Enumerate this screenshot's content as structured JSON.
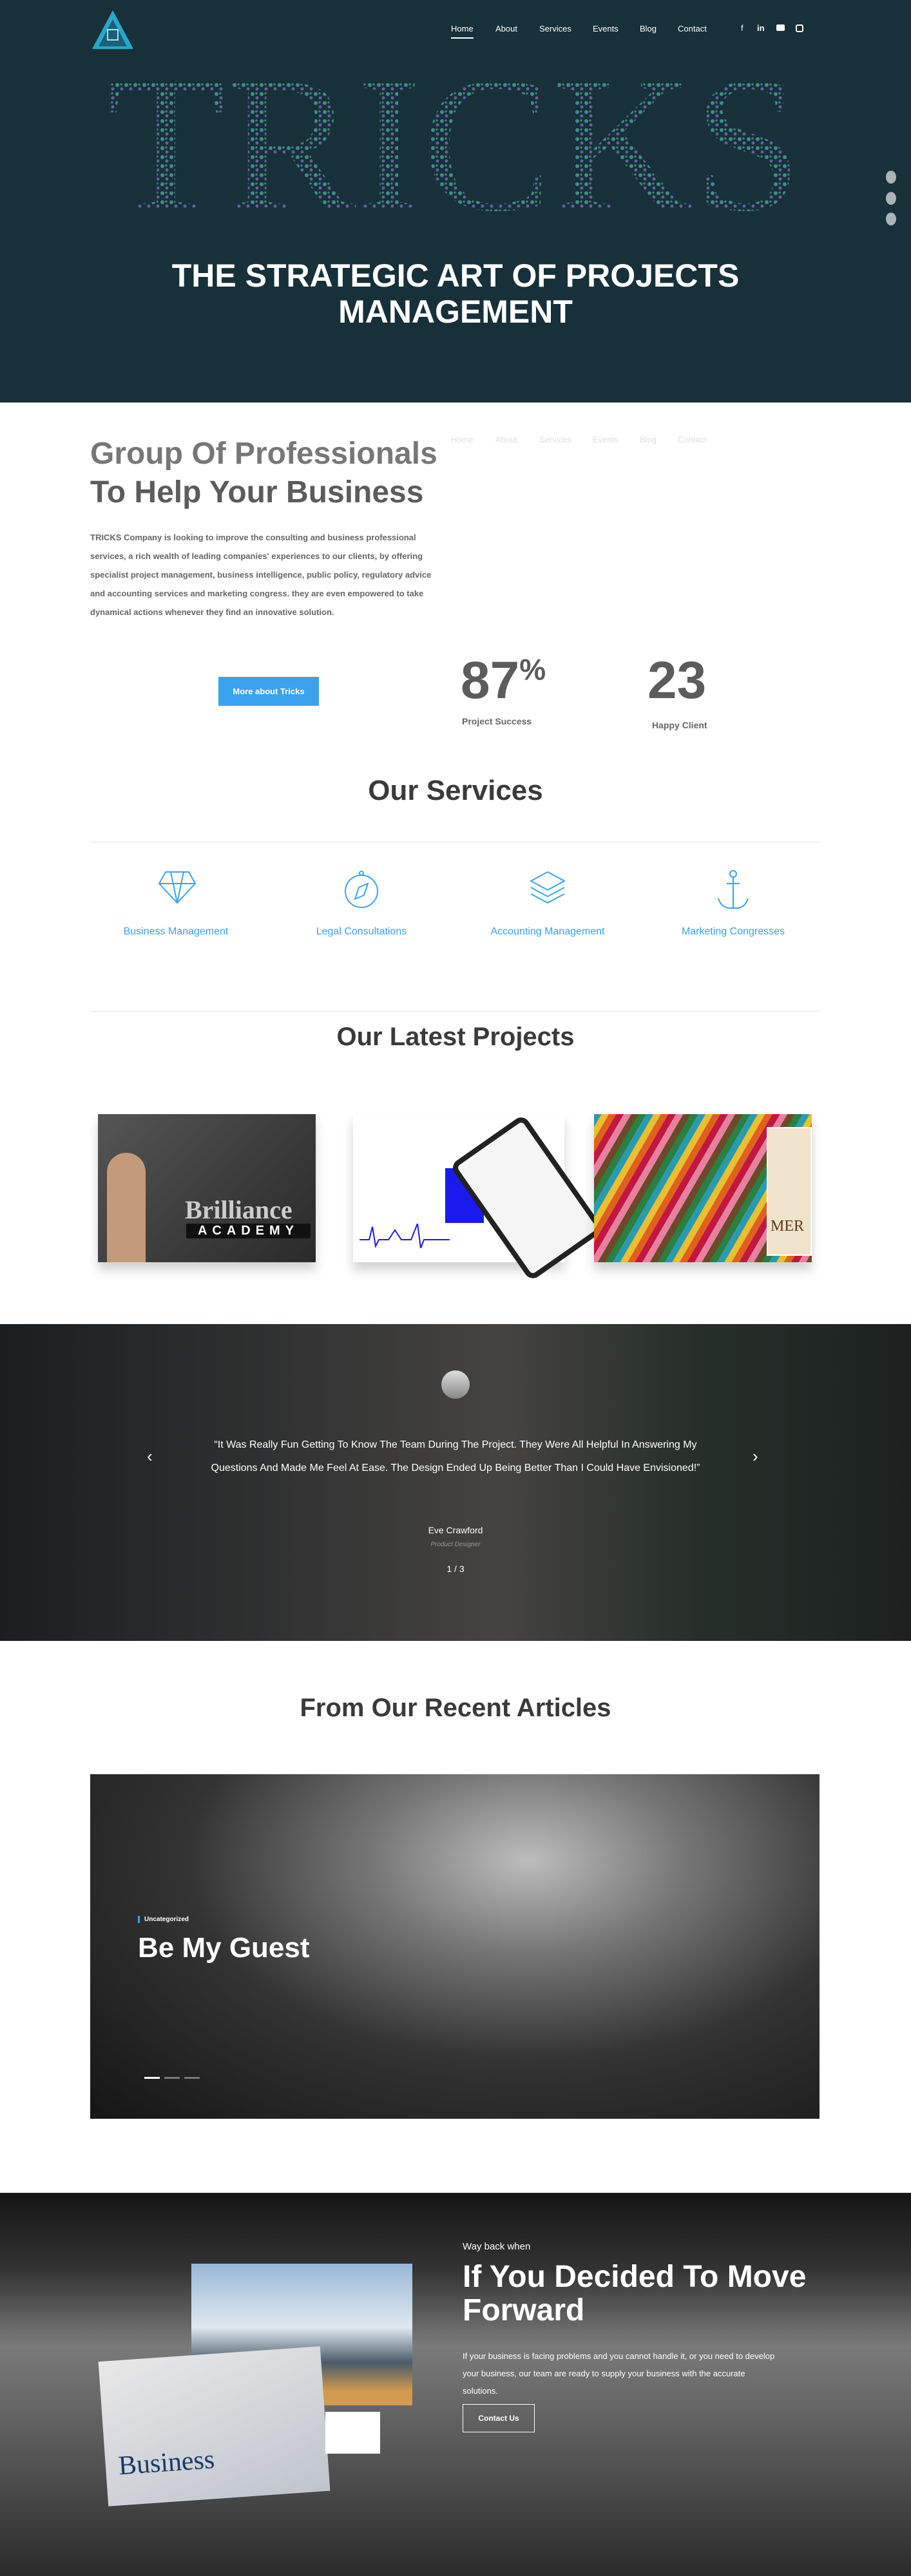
{
  "header": {
    "nav": [
      "Home",
      "About",
      "Services",
      "Events",
      "Blog",
      "Contact"
    ],
    "active": "Home",
    "social_icons": [
      "facebook-icon",
      "linkedin-icon",
      "youtube-icon",
      "instagram-icon"
    ]
  },
  "hero": {
    "big_word": "TRICKS",
    "title_line1": "THE STRATEGIC ART OF PROJECTS",
    "title_line2": "MANAGEMENT"
  },
  "about": {
    "title_line1": "Group Of Professionals",
    "title_line2": "To Help Your Business",
    "body": "TRICKS Company is looking to improve the consulting and business professional services, a rich wealth of leading companies' experiences to our clients, by offering specialist project management, business intelligence, public policy, regulatory advice and accounting services and marketing congress. they are even empowered to take dynamical actions whenever they find an innovative solution.",
    "button": "More about Tricks",
    "stats": [
      {
        "value": "87",
        "suffix": "%",
        "label": "Project Success"
      },
      {
        "value": "23",
        "suffix": "",
        "label": "Happy Client"
      }
    ]
  },
  "services": {
    "title": "Our Services",
    "items": [
      {
        "label": "Business Management",
        "icon": "diamond-icon"
      },
      {
        "label": "Legal Consultations",
        "icon": "compass-icon"
      },
      {
        "label": "Accounting Management",
        "icon": "layers-icon"
      },
      {
        "label": "Marketing Congresses",
        "icon": "anchor-icon"
      }
    ]
  },
  "projects": {
    "title": "Our Latest Projects",
    "items": [
      {
        "brand_line1": "Brilliance",
        "brand_line2": "ACADEMY"
      },
      {
        "brand_line1": ""
      },
      {
        "brand_line1": "MER"
      }
    ]
  },
  "testimonial": {
    "quote": "“It Was Really Fun Getting To Know The Team During The Project. They Were All Helpful In Answering My Questions And Made Me Feel At Ease. The Design Ended Up Being Better Than I Could Have Envisioned!”",
    "name": "Eve Crawford",
    "role": "Product Designer",
    "counter": "1 / 3"
  },
  "articles": {
    "title": "From Our Recent Articles",
    "category": "Uncategorized",
    "post_title": "Be My Guest",
    "slides": 3,
    "active_slide": 1
  },
  "cta": {
    "kicker": "Way back when",
    "title": "If You Decided To Move Forward",
    "body": "If your business is facing problems and you cannot handle it, or you need to develop your business, our team are ready to supply your business with the accurate solutions.",
    "button": "Contact Us",
    "newspaper": "Business"
  },
  "colors": {
    "hero_bg": "#173039",
    "accent": "#3aa3f0"
  }
}
